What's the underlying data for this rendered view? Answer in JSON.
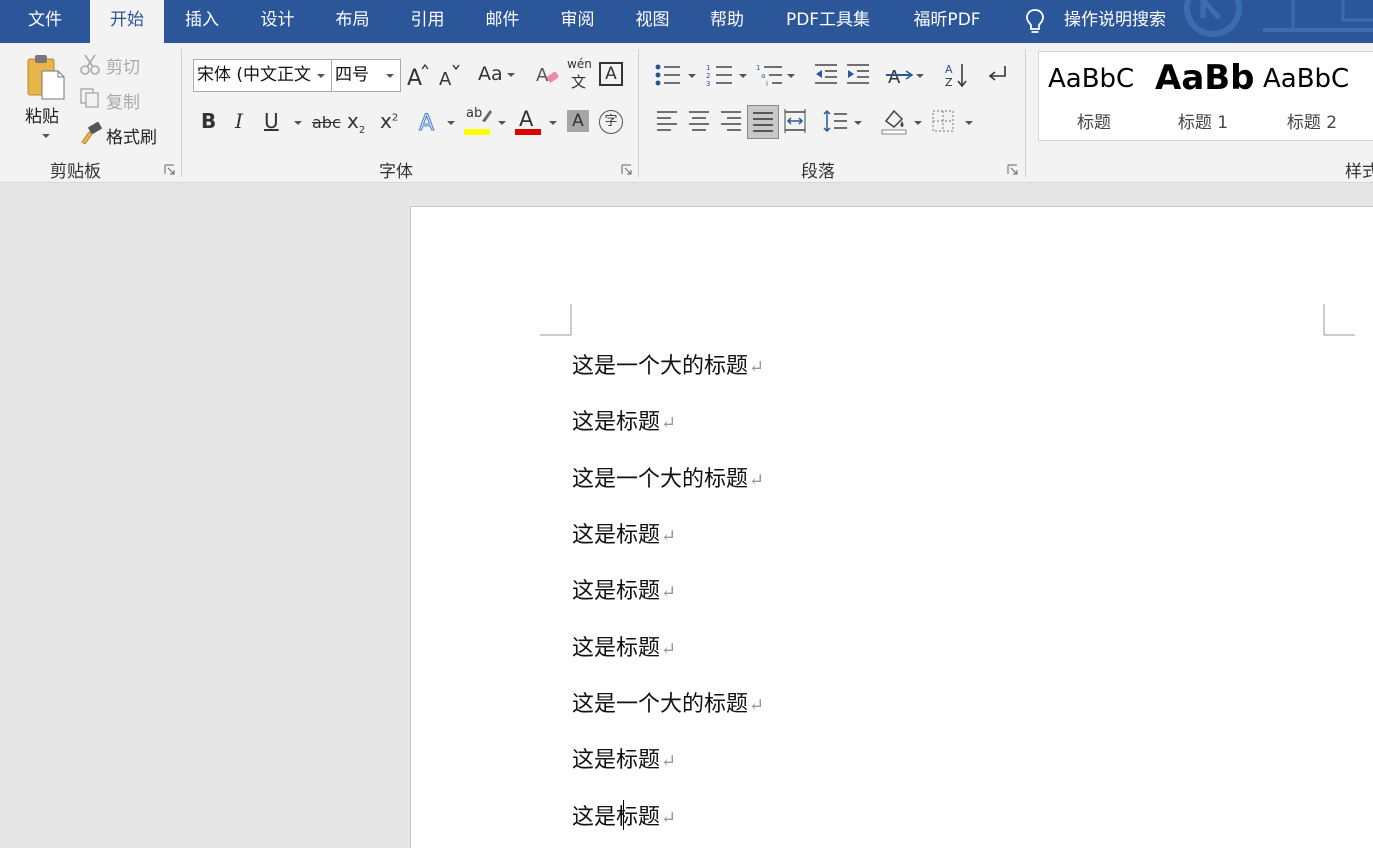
{
  "tabs": [
    {
      "label": "文件",
      "active": false
    },
    {
      "label": "开始",
      "active": true
    },
    {
      "label": "插入",
      "active": false
    },
    {
      "label": "设计",
      "active": false
    },
    {
      "label": "布局",
      "active": false
    },
    {
      "label": "引用",
      "active": false
    },
    {
      "label": "邮件",
      "active": false
    },
    {
      "label": "审阅",
      "active": false
    },
    {
      "label": "视图",
      "active": false
    },
    {
      "label": "帮助",
      "active": false
    },
    {
      "label": "PDF工具集",
      "active": false
    },
    {
      "label": "福昕PDF",
      "active": false
    }
  ],
  "tell_me": {
    "label": "操作说明搜索",
    "icon": "lightbulb-icon"
  },
  "clipboard": {
    "group_label": "剪贴板",
    "paste_label": "粘贴",
    "cut_label": "剪切",
    "copy_label": "复制",
    "format_painter_label": "格式刷"
  },
  "font": {
    "group_label": "字体",
    "font_name": "宋体 (中文正文",
    "font_size": "四号",
    "change_case_label": "Aa",
    "phonetic_top": "wén",
    "phonetic_bottom": "文",
    "char_border_label": "A",
    "bold_label": "B",
    "italic_label": "I",
    "underline_label": "U",
    "strike_label": "abc",
    "subscript_label": "x",
    "superscript_label": "x",
    "highlight_label": "ab",
    "font_color_label": "A",
    "char_shading_label": "A",
    "enclose_label": "字",
    "highlight_color": "#ffff00",
    "font_color": "#e00000"
  },
  "paragraph": {
    "group_label": "段落"
  },
  "styles": {
    "group_label": "样式",
    "items": [
      {
        "sample": "AaBbC",
        "name": "标题"
      },
      {
        "sample": "AaBb",
        "name": "标题 1"
      },
      {
        "sample": "AaBbC",
        "name": "标题 2"
      }
    ]
  },
  "document": {
    "paragraphs": [
      "这是一个大的标题",
      "这是标题",
      "这是一个大的标题",
      "这是标题",
      "这是标题",
      "这是标题",
      "这是一个大的标题",
      "这是标题",
      "这是标题"
    ],
    "paragraph_mark": "↵"
  },
  "colors": {
    "accent": "#2b579a",
    "ribbon_bg": "#f3f3f3",
    "canvas_bg": "#e6e6e6"
  }
}
